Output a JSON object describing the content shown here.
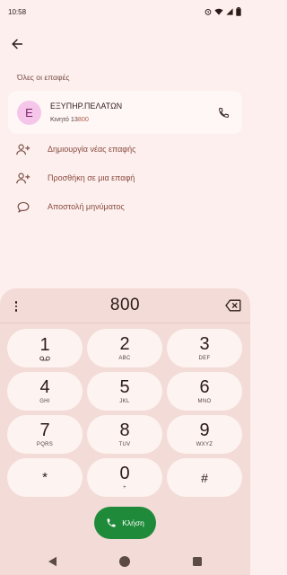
{
  "status_bar": {
    "time": "10:58"
  },
  "header": {
    "section_title": "Όλες οι επαφές"
  },
  "contact": {
    "avatar_letter": "Ε",
    "name": "ΕΞΥΠΗΡ.ΠΕΛΑΤΩΝ",
    "type_label": "Κινητό",
    "number_prefix": "13",
    "number_highlight": "800"
  },
  "actions": [
    {
      "label": "Δημιουργία νέας επαφής",
      "icon": "add-person-icon"
    },
    {
      "label": "Προσθήκη σε μια επαφή",
      "icon": "add-person-icon"
    },
    {
      "label": "Αποστολή μηνύματος",
      "icon": "message-icon"
    }
  ],
  "dialpad": {
    "entered_number": "800",
    "keys": [
      {
        "digit": "1",
        "letters": ""
      },
      {
        "digit": "2",
        "letters": "ABC"
      },
      {
        "digit": "3",
        "letters": "DEF"
      },
      {
        "digit": "4",
        "letters": "GHI"
      },
      {
        "digit": "5",
        "letters": "JKL"
      },
      {
        "digit": "6",
        "letters": "MNO"
      },
      {
        "digit": "7",
        "letters": "PQRS"
      },
      {
        "digit": "8",
        "letters": "TUV"
      },
      {
        "digit": "9",
        "letters": "WXYZ"
      },
      {
        "digit": "*",
        "letters": ""
      },
      {
        "digit": "0",
        "letters": "+"
      },
      {
        "digit": "#",
        "letters": ""
      }
    ],
    "call_label": "Κλήση"
  },
  "colors": {
    "background": "#fcefed",
    "dialpad_background": "#f3dcd8",
    "key_background": "#fdf3f1",
    "call_button": "#1f8a3a",
    "avatar_background": "#f6c6ea",
    "accent_text": "#8a4a40"
  }
}
